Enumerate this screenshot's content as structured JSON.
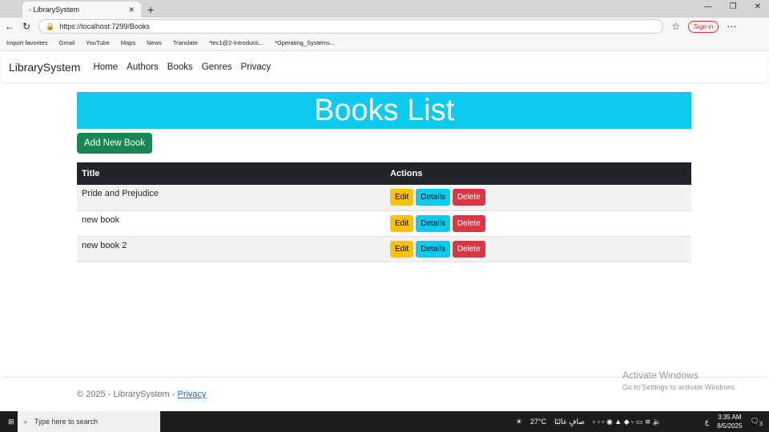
{
  "browser": {
    "tab_title": "- LibrarySystem",
    "url": "https://localhost:7299/Books",
    "sign_in": "Sign in",
    "bookmarks": [
      "Import favorites",
      "Gmail",
      "YouTube",
      "Maps",
      "News",
      "Translate",
      "*lec1@2-Introducti...",
      "*Operating_Systems..."
    ]
  },
  "nav": {
    "brand": "LibrarySystem",
    "links": [
      "Home",
      "Authors",
      "Books",
      "Genres",
      "Privacy"
    ]
  },
  "main": {
    "title": "Books List",
    "add_button": "Add New Book",
    "columns": [
      "Title",
      "Actions"
    ],
    "rows": [
      {
        "title": "Pride and Prejudice"
      },
      {
        "title": "new book"
      },
      {
        "title": "new book 2"
      }
    ],
    "actions": {
      "edit": "Edit",
      "details": "Details",
      "delete": "Delete"
    }
  },
  "footer": {
    "text": "© 2025 - LibrarySystem - ",
    "link": "Privacy"
  },
  "watermark": {
    "title": "Activate Windows",
    "sub": "Go to Settings to activate Windows."
  },
  "taskbar": {
    "search": "Type here to search",
    "weather": "27°C",
    "weather_text": "صافٍ غالبًا",
    "lang": "ع",
    "time": "3:35 AM",
    "date": "8/5/2025",
    "notifications": "3"
  }
}
